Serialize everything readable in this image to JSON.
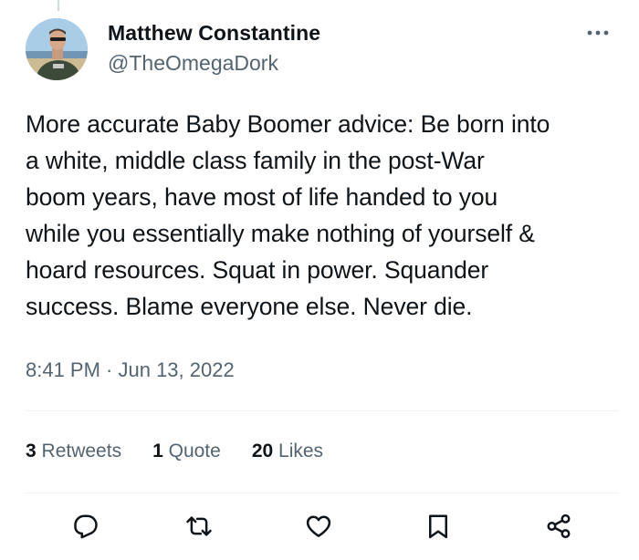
{
  "author": {
    "display_name": "Matthew Constantine",
    "handle": "@TheOmegaDork"
  },
  "tweet": {
    "text": "More accurate Baby Boomer advice: Be born into\na white, middle class family in the post-War\nboom years, have most of life handed to you\nwhile you essentially make nothing of yourself &\nhoard resources. Squat in power. Squander\nsuccess. Blame everyone else. Never die.",
    "timestamp": "8:41 PM · Jun 13, 2022"
  },
  "stats": [
    {
      "count": "3",
      "label": "Retweets"
    },
    {
      "count": "1",
      "label": "Quote"
    },
    {
      "count": "20",
      "label": "Likes"
    }
  ],
  "actions": {
    "icons": [
      "reply-icon",
      "retweet-icon",
      "like-icon",
      "bookmark-icon",
      "share-icon"
    ]
  },
  "colors": {
    "text_primary": "#0f1419",
    "text_secondary": "#536471",
    "divider": "#eff3f4"
  }
}
